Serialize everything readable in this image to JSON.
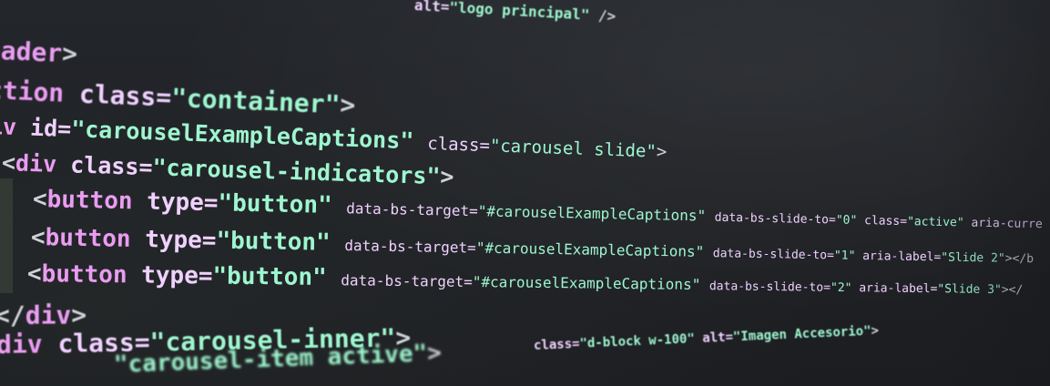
{
  "code": {
    "line1": {
      "attr": "alt=",
      "value": "\"logo principal\"",
      "close": " />"
    },
    "line2": {
      "tag": "eader",
      "close": ">"
    },
    "line3": {
      "tag": "ction",
      "attr": "class=",
      "value": "\"container\"",
      "close": ">"
    },
    "line4": {
      "tag": "iv",
      "attr1": "id=",
      "value1": "\"carouselExampleCaptions\"",
      "attr2": "class=",
      "value2": "\"carousel slide\"",
      "close": ">"
    },
    "line5": {
      "open": "<",
      "tag": "div",
      "attr": "class=",
      "value": "\"carousel-indicators\"",
      "close": ">"
    },
    "buttons": [
      {
        "open": "<",
        "tag": "button",
        "type_attr": "type=",
        "type_value": "\"button\"",
        "target_attr": "data-bs-target=",
        "target_value": "\"#carouselExampleCaptions\"",
        "slide_attr": "data-bs-slide-to=",
        "slide_value": "\"0\"",
        "extra_attr": "class=",
        "extra_value": "\"active\"",
        "tail": " aria-curre"
      },
      {
        "open": "<",
        "tag": "button",
        "type_attr": "type=",
        "type_value": "\"button\"",
        "target_attr": "data-bs-target=",
        "target_value": "\"#carouselExampleCaptions\"",
        "slide_attr": "data-bs-slide-to=",
        "slide_value": "\"1\"",
        "extra_attr": "aria-label=",
        "extra_value": "\"Slide 2\"",
        "tail": "></b"
      },
      {
        "open": "<",
        "tag": "button",
        "type_attr": "type=",
        "type_value": "\"button\"",
        "target_attr": "data-bs-target=",
        "target_value": "\"#carouselExampleCaptions\"",
        "slide_attr": "data-bs-slide-to=",
        "slide_value": "\"2\"",
        "extra_attr": "aria-label=",
        "extra_value": "\"Slide 3\"",
        "tail": "></"
      }
    ],
    "line9": {
      "open": "</",
      "tag": "div",
      "close": ">"
    },
    "line10": {
      "tag": "div",
      "attr": "class=",
      "value": "\"carousel-inner\"",
      "close": ">"
    },
    "line11": {
      "value": "\"carousel-item active\"",
      "close": ">"
    },
    "line12": {
      "attr1": "class=",
      "value1": "\"d-block w-100\"",
      "attr2": "alt=",
      "value2": "\"Imagen Accesorio\"",
      "close": ">"
    }
  },
  "colors": {
    "background": "#1f2126",
    "tag": "#ea9cf1",
    "attribute": "#f0d1ff",
    "string": "#9ef6cf",
    "punctuation": "#cfd3d8"
  }
}
